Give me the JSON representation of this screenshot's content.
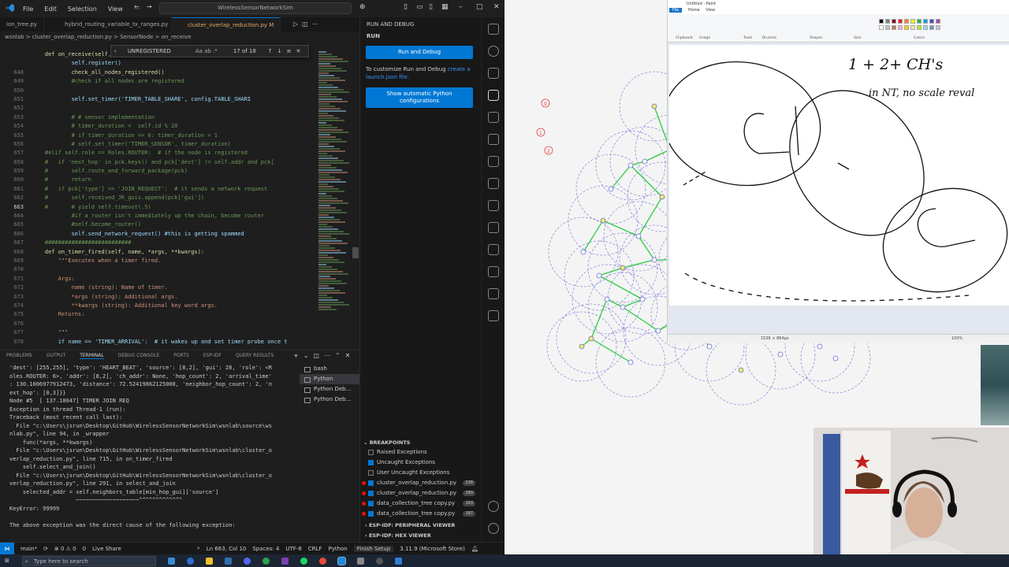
{
  "vscode": {
    "menu": [
      "File",
      "Edit",
      "Selection",
      "View"
    ],
    "search": "WirelessSensorNetworkSim",
    "tabs": [
      {
        "label": "ion_tree.py",
        "active": false
      },
      {
        "label": "hybrid_routing_variable_tx_ranges.py",
        "active": false
      },
      {
        "label": "cluster_overlap_reduction.py M",
        "active": true
      }
    ],
    "breadcrumb": "wsnlab  >  cluster_overlap_reduction.py  >  SensorNode  >  on_receive",
    "find": {
      "term": "UNREGISTERED",
      "opts": "Aa  ab  .*",
      "count": "17 of 18"
    },
    "hidden_first_line": "class SensorNode(wsn.Node):",
    "code_lines": [
      {
        "n": "",
        "t": "    def on_receive(self, pck):",
        "c": "def"
      },
      {
        "n": "",
        "t": "            self.register()",
        "c": ""
      },
      {
        "n": "648",
        "t": "            check_all_nodes_registered()",
        "c": "kw"
      },
      {
        "n": "649",
        "t": "            #check if all nodes are registered",
        "c": "cm"
      },
      {
        "n": "650",
        "t": "",
        "c": ""
      },
      {
        "n": "651",
        "t": "            self.set_timer('TIMER_TABLE_SHARE', config.TABLE_SHARI",
        "c": ""
      },
      {
        "n": "652",
        "t": "",
        "c": ""
      },
      {
        "n": "653",
        "t": "            # # sensor implementation",
        "c": "cm"
      },
      {
        "n": "654",
        "t": "            # timer_duration =  self.id % 20",
        "c": "cm"
      },
      {
        "n": "655",
        "t": "            # if timer_duration == 0: timer_duration = 1",
        "c": "cm"
      },
      {
        "n": "656",
        "t": "            # self.set_timer('TIMER_SENSOR', timer_duration)",
        "c": "cm"
      },
      {
        "n": "657",
        "t": "    #elif self.role == Roles.ROUTER:  # if the node is registered",
        "c": "cm"
      },
      {
        "n": "658",
        "t": "    #   if 'next_hop' in pck.keys() and pck['dest'] != self.addr and pck[",
        "c": "cm"
      },
      {
        "n": "659",
        "t": "    #       self.route_and_forward_package(pck)",
        "c": "cm"
      },
      {
        "n": "660",
        "t": "    #       return",
        "c": "cm"
      },
      {
        "n": "661",
        "t": "    #   if pck['type'] == 'JOIN_REQUEST':  # it sends a network request",
        "c": "cm"
      },
      {
        "n": "662",
        "t": "    #       self.received_JR_guis.append(pck['gui'])",
        "c": "cm"
      },
      {
        "n": "663",
        "t": "    #       # yield self.timeout(.5)",
        "c": "cm"
      },
      {
        "n": "664",
        "t": "            #if a router isn't immediately up the chain, become router",
        "c": "cm"
      },
      {
        "n": "665",
        "t": "            #self.become_router()",
        "c": "cm"
      },
      {
        "n": "666",
        "t": "            self.send_network_request() #this is getting spammed",
        "c": ""
      },
      {
        "n": "667",
        "t": "    ##########################",
        "c": "cm"
      },
      {
        "n": "668",
        "t": "    def on_timer_fired(self, name, *args, **kwargs):",
        "c": "def"
      },
      {
        "n": "669",
        "t": "        \"\"\"Executes when a timer fired.",
        "c": "str"
      },
      {
        "n": "670",
        "t": "",
        "c": ""
      },
      {
        "n": "671",
        "t": "        Args:",
        "c": "str"
      },
      {
        "n": "672",
        "t": "            name (string): Name of timer.",
        "c": "str"
      },
      {
        "n": "673",
        "t": "            *args (string): Additional args.",
        "c": "str"
      },
      {
        "n": "674",
        "t": "            **kwargs (string): Additional key word args.",
        "c": "str"
      },
      {
        "n": "675",
        "t": "        Returns:",
        "c": "str"
      },
      {
        "n": "676",
        "t": "",
        "c": ""
      },
      {
        "n": "677",
        "t": "        \"\"\"",
        "c": "str"
      },
      {
        "n": "678",
        "t": "        if name == 'TIMER_ARRIVAL':  # it wakes up and set timer probe once t",
        "c": ""
      }
    ],
    "current_line": "663",
    "panel_tabs": [
      "PROBLEMS",
      "OUTPUT",
      "TERMINAL",
      "DEBUG CONSOLE",
      "PORTS",
      "ESP-IDF",
      "QUERY RESULTS"
    ],
    "terminal_text": "'dest': [255,255], 'type': 'HEART_BEAT', 'source': [8,2], 'gui': 28, 'role': <R\noles.ROUTER: 6>, 'addr': [8,2], 'ch_addr': None, 'hop_count': 2, 'arrival_time'\n: 130.1006977912473, 'distance': 72.52419862125008, 'neighbor_hop_count': 2, 'n\next_hop': [0,3]}}\nNode #5  [ 137.10047] TIMER JOIN REQ\nException in thread Thread-1 (run):\nTraceback (most recent call last):\n  File \"c:\\Users\\jsrun\\Desktop\\GitHub\\WirelessSensorNetworkSim\\wsnlab\\source\\ws\nnlab.py\", line 94, in _wrapper\n    func(*args, **kwargs)\n  File \"c:\\Users\\jsrun\\Desktop\\GitHub\\WirelessSensorNetworkSim\\wsnlab\\cluster_o\nverlap_reduction.py\", line 715, in on_timer_fired\n    self.select_and_join()\n  File \"c:\\Users\\jsrun\\Desktop\\GitHub\\WirelessSensorNetworkSim\\wsnlab\\cluster_o\nverlap_reduction.py\", line 291, in select_and_join\n    selected_addr = self.neighbors_table[min_hop_gui]['source']\n                    ~~~~~~~~~~~~~~~~~~~^^^^^^^^^^^^^\nKeyError: 99999\n\nThe above exception was the direct cause of the following exception:",
    "terminal_list": [
      {
        "label": "bash",
        "active": false
      },
      {
        "label": "Python",
        "active": true
      },
      {
        "label": "Python Deb...",
        "active": false
      },
      {
        "label": "Python Deb...",
        "active": false
      }
    ],
    "run": {
      "header": "RUN AND DEBUG",
      "section": "RUN",
      "run_button": "Run and Debug",
      "hint_pre": "To customize Run and Debug",
      "hint_link": "create a launch.json file.",
      "python_button": "Show automatic Python configurations"
    },
    "breakpoints": {
      "title": "BREAKPOINTS",
      "items": [
        {
          "label": "Raised Exceptions",
          "checked": false,
          "dot": false,
          "line": ""
        },
        {
          "label": "Uncaught Exceptions",
          "checked": true,
          "dot": false,
          "line": ""
        },
        {
          "label": "User Uncaught Exceptions",
          "checked": false,
          "dot": false,
          "line": ""
        },
        {
          "label": "cluster_overlap_reduction.py",
          "checked": true,
          "dot": true,
          "line": "238"
        },
        {
          "label": "cluster_overlap_reduction.py",
          "checked": true,
          "dot": true,
          "line": "289"
        },
        {
          "label": "data_collection_tree copy.py",
          "checked": true,
          "dot": true,
          "line": "163"
        },
        {
          "label": "data_collection_tree copy.py",
          "checked": true,
          "dot": true,
          "line": "167"
        }
      ],
      "collapsed": [
        "ESP-IDF: PERIPHERAL VIEWER",
        "ESP-IDF: HEX VIEWER"
      ]
    },
    "status": {
      "branch": "main*",
      "errors": "⊗ 0  ⚠ 0",
      "ports": "0",
      "live_share": "Live Share",
      "position": "Ln 663, Col 10",
      "spaces": "Spaces: 4",
      "encoding": "UTF-8",
      "eol": "CRLF",
      "lang": "Python",
      "finish": "Finish Setup",
      "interpreter": "3.11.9 (Microsoft Store)"
    }
  },
  "sim": {
    "labels": [
      "0",
      "1",
      "2"
    ],
    "colors": {
      "circle": "#6a6ad8",
      "link": "#2ecc40",
      "node_yellow": "#f1e96b"
    }
  },
  "paint": {
    "title": "Untitled - Paint",
    "tabs": [
      "File",
      "Home",
      "View"
    ],
    "groups": [
      "Clipboard",
      "Image",
      "Tools",
      "Brushes",
      "Shapes",
      "Size",
      "Colors"
    ],
    "handwriting": [
      "1 + 2+  CH's",
      "in NT, no scale reval"
    ],
    "status_size": "1536 × 864px",
    "zoom": "100%"
  },
  "taskbar": {
    "search": "Type here to search"
  }
}
